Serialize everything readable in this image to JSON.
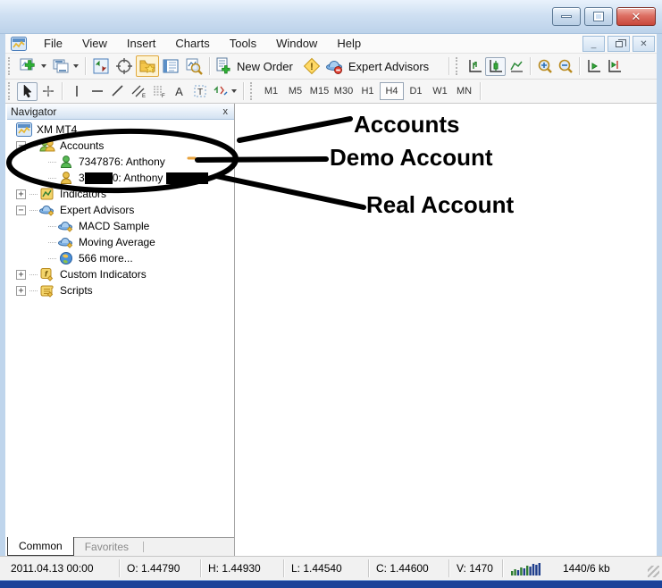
{
  "window": {
    "controls": {
      "minimize": "minimize",
      "maximize": "maximize",
      "close": "close"
    },
    "mdi_controls": {
      "minimize": "_",
      "restore": "restore",
      "close": "x"
    }
  },
  "menu": {
    "items": [
      "File",
      "View",
      "Insert",
      "Charts",
      "Tools",
      "Window",
      "Help"
    ]
  },
  "toolbar": {
    "new_order": "New Order",
    "expert_advisors": "Expert Advisors",
    "timeframes": [
      "M1",
      "M5",
      "M15",
      "M30",
      "H1",
      "H4",
      "D1",
      "W1",
      "MN"
    ],
    "selected_timeframe": "H4",
    "text_tool": "A"
  },
  "navigator": {
    "title": "Navigator",
    "close": "x",
    "tree": {
      "xm_mt4": "XM MT4",
      "accounts": "Accounts",
      "demo_account": "7347876: Anthony",
      "real_account_prefix": "3",
      "real_account_mid": "0: Anthony",
      "indicators": "Indicators",
      "expert_advisors": "Expert Advisors",
      "macd_sample": "MACD Sample",
      "moving_average": "Moving Average",
      "more": "566 more...",
      "custom_indicators": "Custom Indicators",
      "scripts": "Scripts"
    },
    "tabs": {
      "common": "Common",
      "favorites": "Favorites"
    }
  },
  "annotations": {
    "accounts_label": "Accounts",
    "demo_label": "Demo Account",
    "real_label": "Real Account",
    "color": "#000000"
  },
  "status_bar": {
    "datetime": "2011.04.13 00:00",
    "open": "O: 1.44790",
    "high": "H: 1.44930",
    "low": "L: 1.44540",
    "close": "C: 1.44600",
    "volume": "V: 1470",
    "traffic": "1440/6 kb"
  },
  "colors": {
    "frame_blue": "#bfd5ec",
    "close_red": "#c8473a",
    "bottom_strip": "#1c4399",
    "demo_green": "#3fae49",
    "real_gold": "#dfaf2c",
    "ea_hat_blue": "#7fb2e5"
  }
}
